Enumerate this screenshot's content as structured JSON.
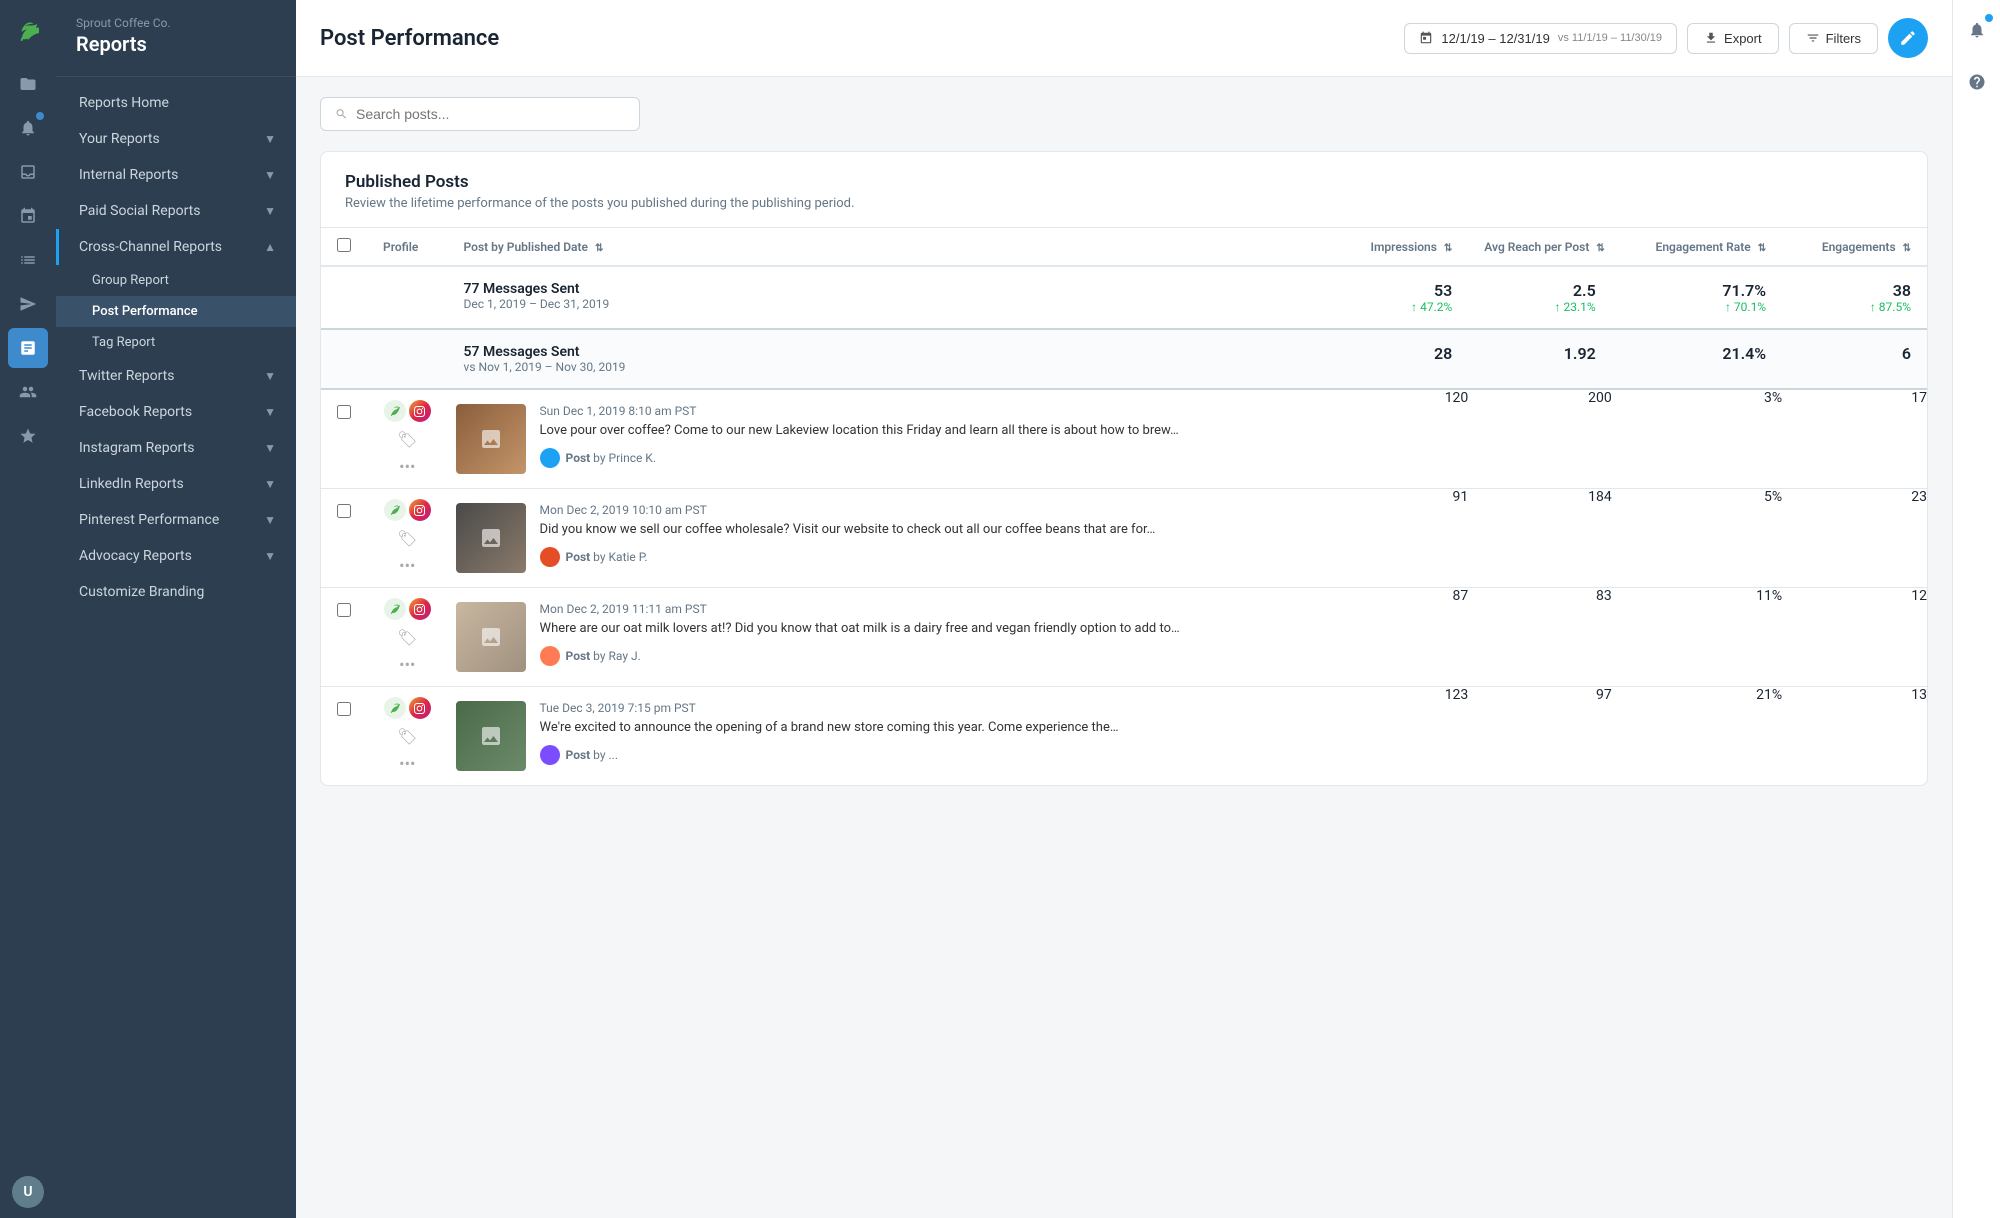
{
  "app": {
    "company": "Sprout Coffee Co.",
    "section": "Reports"
  },
  "sidebar": {
    "navItems": [
      {
        "id": "reports-home",
        "label": "Reports Home",
        "level": 0,
        "active": false
      },
      {
        "id": "your-reports",
        "label": "Your Reports",
        "level": 0,
        "hasChildren": true,
        "active": false
      },
      {
        "id": "internal-reports",
        "label": "Internal Reports",
        "level": 0,
        "hasChildren": true,
        "active": false
      },
      {
        "id": "paid-social",
        "label": "Paid Social Reports",
        "level": 0,
        "hasChildren": true,
        "active": false
      },
      {
        "id": "cross-channel",
        "label": "Cross-Channel Reports",
        "level": 0,
        "hasChildren": true,
        "active": true
      },
      {
        "id": "group-report",
        "label": "Group Report",
        "level": 1,
        "active": false
      },
      {
        "id": "post-performance",
        "label": "Post Performance",
        "level": 1,
        "active": true
      },
      {
        "id": "tag-report",
        "label": "Tag Report",
        "level": 1,
        "active": false
      },
      {
        "id": "twitter-reports",
        "label": "Twitter Reports",
        "level": 0,
        "hasChildren": true,
        "active": false
      },
      {
        "id": "facebook-reports",
        "label": "Facebook Reports",
        "level": 0,
        "hasChildren": true,
        "active": false
      },
      {
        "id": "instagram-reports",
        "label": "Instagram Reports",
        "level": 0,
        "hasChildren": true,
        "active": false
      },
      {
        "id": "linkedin-reports",
        "label": "LinkedIn Reports",
        "level": 0,
        "hasChildren": true,
        "active": false
      },
      {
        "id": "pinterest",
        "label": "Pinterest Performance",
        "level": 0,
        "hasChildren": true,
        "active": false
      },
      {
        "id": "advocacy",
        "label": "Advocacy Reports",
        "level": 0,
        "hasChildren": true,
        "active": false
      },
      {
        "id": "customize-branding",
        "label": "Customize Branding",
        "level": 0,
        "active": false
      }
    ]
  },
  "header": {
    "title": "Post Performance",
    "dateRange": "12/1/19 – 12/31/19",
    "compareRange": "vs 11/1/19 – 11/30/19",
    "exportLabel": "Export",
    "filtersLabel": "Filters"
  },
  "search": {
    "placeholder": "Search posts..."
  },
  "publishedPosts": {
    "title": "Published Posts",
    "description": "Review the lifetime performance of the posts you published during the publishing period.",
    "columns": {
      "profile": "Profile",
      "postByDate": "Post by Published Date",
      "impressions": "Impressions",
      "avgReach": "Avg Reach per Post",
      "engagementRate": "Engagement Rate",
      "engagements": "Engagements"
    },
    "summaryCurrentRow": {
      "label": "77 Messages Sent",
      "dateRange": "Dec 1, 2019 – Dec 31, 2019",
      "impressions": "53",
      "impressionsChange": "↑ 47.2%",
      "avgReach": "2.5",
      "avgReachChange": "↑ 23.1%",
      "engagementRate": "71.7%",
      "engagementRateChange": "↑ 70.1%",
      "engagements": "38",
      "engagementsChange": "↑ 87.5%"
    },
    "summaryPrevRow": {
      "label": "57 Messages Sent",
      "dateRange": "vs Nov 1, 2019 – Nov 30, 2019",
      "impressions": "28",
      "avgReach": "1.92",
      "engagementRate": "21.4%",
      "engagements": "6"
    },
    "posts": [
      {
        "id": "post-1",
        "date": "Sun Dec 1, 2019 8:10 am PST",
        "text": "Love pour over coffee? Come to our new Lakeview location this Friday and learn all there is about how to brew…",
        "author": "Post by Prince K.",
        "impressions": "120",
        "avgReach": "200",
        "engagementRate": "3%",
        "engagements": "17",
        "thumbClass": "thumb-coffee"
      },
      {
        "id": "post-2",
        "date": "Mon Dec 2, 2019 10:10 am PST",
        "text": "Did you know we sell our coffee wholesale? Visit our website to check out all our coffee beans that are for…",
        "author": "Post by Katie P.",
        "impressions": "91",
        "avgReach": "184",
        "engagementRate": "5%",
        "engagements": "23",
        "thumbClass": "thumb-wholesale"
      },
      {
        "id": "post-3",
        "date": "Mon Dec 2, 2019 11:11 am PST",
        "text": "Where are our oat milk lovers at!? Did you know that oat milk is a dairy free and vegan friendly option to add to…",
        "author": "Post by Ray J.",
        "impressions": "87",
        "avgReach": "83",
        "engagementRate": "11%",
        "engagements": "12",
        "thumbClass": "thumb-oat"
      },
      {
        "id": "post-4",
        "date": "Tue Dec 3, 2019 7:15 pm PST",
        "text": "We're excited to announce the opening of a brand new store coming this year. Come experience the…",
        "author": "Post by ...",
        "impressions": "123",
        "avgReach": "97",
        "engagementRate": "21%",
        "engagements": "13",
        "thumbClass": "thumb-announce"
      }
    ]
  }
}
